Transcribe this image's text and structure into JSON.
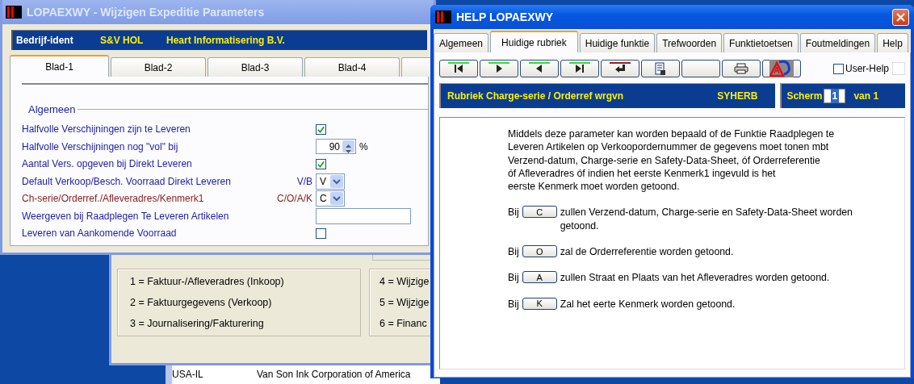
{
  "main_window": {
    "title": "LOPAEXWY - Wijzigen Expeditie Parameters",
    "header": {
      "label": "Bedrijf-ident",
      "code": "S&V HOL",
      "company": "Heart Informatisering B.V."
    },
    "tabs": [
      {
        "label": "Blad-1",
        "selected": true
      },
      {
        "label": "Blad-2",
        "selected": false
      },
      {
        "label": "Blad-3",
        "selected": false
      },
      {
        "label": "Blad-4",
        "selected": false
      }
    ],
    "group": {
      "title": "Algemeen",
      "rows": [
        {
          "kind": "checkbox",
          "label": "Halfvolle Verschijningen zijn te Leveren",
          "color": "#1c1ca8",
          "checked": true
        },
        {
          "kind": "spinner",
          "label": "Halfvolle Verschijningen nog \"vol\" bij",
          "color": "#1c1ca8",
          "value": "90",
          "unit": "%"
        },
        {
          "kind": "checkbox",
          "label": "Aantal Vers. opgeven bij Direkt Leveren",
          "color": "#1c1ca8",
          "checked": true
        },
        {
          "kind": "select",
          "label": "Default Verkoop/Besch. Voorraad Direkt Leveren",
          "color": "#1c1ca8",
          "hint": "V/B",
          "value": "V"
        },
        {
          "kind": "select",
          "label": "Ch-serie/Orderref./Afleveradres/Kenmerk1",
          "color": "#8b1a1a",
          "hint": "C/O/A/K",
          "value": "C"
        },
        {
          "kind": "text",
          "label": "Weergeven bij Raadplegen Te Leveren Artikelen",
          "color": "#1c1ca8"
        },
        {
          "kind": "checkbox",
          "label": "Leveren van Aankomende Voorraad",
          "color": "#1c1ca8",
          "checked": false
        }
      ]
    }
  },
  "background_window": {
    "legend_left": [
      "1 = Faktuur-/Afleveradres (Inkoop)",
      "2 = Faktuurgegevens (Verkoop)",
      "3 = Journalisering/Fakturering"
    ],
    "legend_right": [
      "4 = Wijzige",
      "5 = Wijzige",
      "6 = Financ"
    ],
    "list_row": {
      "code": "USA-IL",
      "name": "Van Son Ink Corporation of America"
    }
  },
  "help_window": {
    "title": "HELP LOPAEXWY",
    "tabs": [
      {
        "label": "Algemeen",
        "selected": false
      },
      {
        "label": "Huidige rubriek",
        "selected": true
      },
      {
        "label": "Huidige funktie",
        "selected": false
      },
      {
        "label": "Trefwoorden",
        "selected": false
      },
      {
        "label": "Funktietoetsen",
        "selected": false
      },
      {
        "label": "Foutmeldingen",
        "selected": false
      },
      {
        "label": "Help",
        "selected": false
      }
    ],
    "toolbar": [
      {
        "kind": "first",
        "color": "#33dd33"
      },
      {
        "kind": "next",
        "color": "#33dd33"
      },
      {
        "kind": "prev",
        "color": "#33dd33"
      },
      {
        "kind": "last",
        "color": "#33dd33"
      },
      {
        "kind": "back",
        "color": "#9a2020"
      },
      {
        "kind": "document"
      },
      {
        "kind": "blank"
      },
      {
        "kind": "print"
      },
      {
        "kind": "tool"
      }
    ],
    "user_help": {
      "label": "User-Help",
      "checked": false
    },
    "rubriek": {
      "title": "Rubriek Charge-serie / Orderref wrgvn",
      "code": "SYHERB"
    },
    "screen": {
      "label": "Scherm",
      "value": "1",
      "total": "van 1"
    },
    "intro": [
      "Middels deze parameter kan worden bepaald of de Funktie Raadplegen te",
      "Leveren Artikelen op Verkoopordernummer de gegevens moet tonen mbt",
      "Verzend-datum, Charge-serie en Safety-Data-Sheet, óf Orderreferentie",
      "óf Afleveradres óf indien het eerste Kenmerk1 ingevuld is het",
      "eerste Kenmerk moet worden getoond."
    ],
    "options": [
      {
        "prefix": "Bij",
        "key": "C",
        "text": "zullen Verzend-datum, Charge-serie en Safety-Data-Sheet worden getoond."
      },
      {
        "prefix": "Bij",
        "key": "O",
        "text": "zal de Orderreferentie worden getoond."
      },
      {
        "prefix": "Bij",
        "key": "A",
        "text": "zullen Straat en Plaats van het Afleveradres worden getoond."
      },
      {
        "prefix": "Bij",
        "key": "K",
        "text": "Zal het eerte Kenmerk worden getoond."
      }
    ]
  }
}
